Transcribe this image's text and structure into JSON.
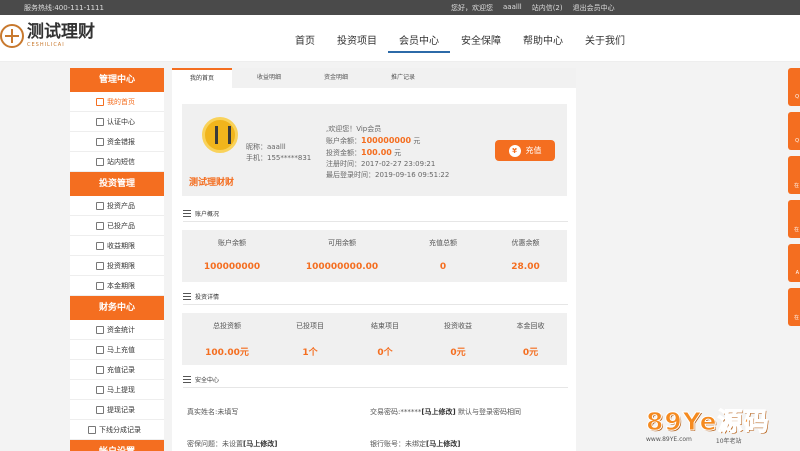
{
  "topbar": {
    "hotline": "服务热线:400-111-1111",
    "greeting": "您好，欢迎您",
    "username": "aaalll",
    "messages": "站内信(2)",
    "logout": "退出会员中心"
  },
  "header": {
    "logo_title": "测试理财",
    "logo_sub": "CESHILICAI",
    "nav": [
      {
        "label": "首页"
      },
      {
        "label": "投资项目"
      },
      {
        "label": "会员中心"
      },
      {
        "label": "安全保障"
      },
      {
        "label": "帮助中心"
      },
      {
        "label": "关于我们"
      }
    ]
  },
  "sidebar": {
    "groups": [
      {
        "title": "管理中心",
        "items": [
          "我的首页",
          "认证中心",
          "资金错报",
          "站内短信"
        ]
      },
      {
        "title": "投资管理",
        "items": [
          "投资产品",
          "已投产品",
          "收益期限",
          "投资期限",
          "本金期限"
        ]
      },
      {
        "title": "财务中心",
        "items": [
          "资金统计",
          "马上充值",
          "充值记录",
          "马上提现",
          "提现记录",
          "下线分成记录"
        ]
      },
      {
        "title": "帐户设置"
      }
    ]
  },
  "tabs": [
    "我的首页",
    "收益明细",
    "资金明细",
    "推广记录"
  ],
  "profile": {
    "brand": "测试理财财",
    "nick_label": "昵称：aaalll",
    "phone_label": "手机：155*****831",
    "welcome": ",欢迎您！Vip会员",
    "balance_label": "账户余额：",
    "balance_value": "100000000",
    "balance_unit": "元",
    "invest_label": "投资金额：",
    "invest_value": "100.00",
    "invest_unit": "元",
    "register_time": "注册时间：2017-02-27 23:09:21",
    "last_login": "最后登录时间：2019-09-16 09:51:22",
    "recharge_icon": "¥",
    "recharge_label": "充值"
  },
  "account_overview": {
    "title": "账户概况",
    "items": [
      {
        "label": "账户余额",
        "value": "100000000"
      },
      {
        "label": "可用余额",
        "value": "100000000.00"
      },
      {
        "label": "充值总额",
        "value": "0"
      },
      {
        "label": "优惠余额",
        "value": "28.00"
      }
    ]
  },
  "invest_overview": {
    "title": "投资详情",
    "items": [
      {
        "label": "总投资额",
        "value": "100.00元"
      },
      {
        "label": "已投项目",
        "value": "1个"
      },
      {
        "label": "结束项目",
        "value": "0个"
      },
      {
        "label": "投资收益",
        "value": "0元"
      },
      {
        "label": "本金回收",
        "value": "0元"
      }
    ]
  },
  "security": {
    "title": "安全中心",
    "realname": "真实姓名:未填写",
    "trade_pwd": "交易密码:******",
    "trade_edit": "[马上修改]",
    "trade_note": "默认与登录密码相同",
    "question": "密保问题：未设置",
    "question_edit": "[马上修改]",
    "bank": "银行账号：未绑定",
    "bank_edit": "[马上修改]"
  },
  "float_tabs": [
    "Q",
    "Q",
    "在",
    "在",
    "A",
    "在"
  ],
  "watermark": {
    "text": "89Ye源码",
    "url": "www.89YE.com",
    "slogan": "10年老站"
  }
}
